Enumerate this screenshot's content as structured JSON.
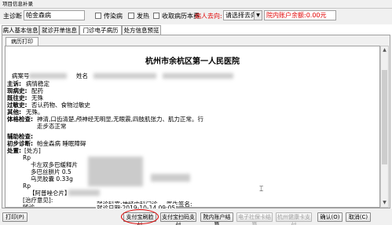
{
  "window": {
    "title": "项目信息补录"
  },
  "form": {
    "diagnosis_label": "主诊断",
    "diagnosis_value": "帕金森病",
    "checkbox_infectious": "传染病",
    "checkbox_fever": "发热",
    "checkbox_record_fee": "收取病历本费",
    "destination_label": "病人去向:",
    "destination_value": "请选择去向",
    "balance_text": "院内账户余额:0.00元"
  },
  "tabs": [
    "病人基本信息",
    "就诊开单信息",
    "门诊电子病历",
    "处方信息预览"
  ],
  "active_tab": 2,
  "subtab": "病历打印",
  "record": {
    "hospital": "杭州市余杭区第一人民医院",
    "record_no_label": "病案号",
    "name_label": "姓名",
    "complaint_label": "主诉:",
    "complaint_value": "病情稳定",
    "present_label": "现病史:",
    "present_value": "配药",
    "past_label": "既往史:",
    "past_value": "无殊",
    "allergy_label": "过敏史:",
    "allergy_value": "否认药物、食物过敏史",
    "other_label": "其他:",
    "other_value": "无殊。",
    "exam_label": "体格检查:",
    "exam_value_1": "神清,口齿清楚,颅神经无明显,无眼震,四肢肌张力、肌力正常。行",
    "exam_value_2": "走步态正常",
    "aux_label": "辅助检查:",
    "prelim_label": "初步诊断:",
    "prelim_value": "帕金森病 睡眠障碍",
    "treatment_label": "处置:",
    "treatment_value": "[处方]",
    "rp1": "Rp",
    "drug1": "卡左双多巴缓释片",
    "drug2": "多巴丝肼片 0.5",
    "drug3": "乌灵胶囊 0.33g",
    "rp2": "Rp",
    "special": "【阿普唑仑片】",
    "advice_label": "[治疗意见]:",
    "followup": "随诊",
    "department": "就诊科室:神经内科门诊",
    "doctor_label": "医生签名:",
    "visit_date": "就诊日期:2019-10-14 09:05"
  },
  "buttons": {
    "print": "打印(P)",
    "alipay_pay": "支付宝刷脸付",
    "alipay_scan": "支付宝扫码支付",
    "hospital_settle": "院内账户结算",
    "social_settle": "电子社保卡结算",
    "health_card_pay": "杭州健康卡支付",
    "confirm": "确认(O)",
    "cancel": "取消(C)"
  }
}
